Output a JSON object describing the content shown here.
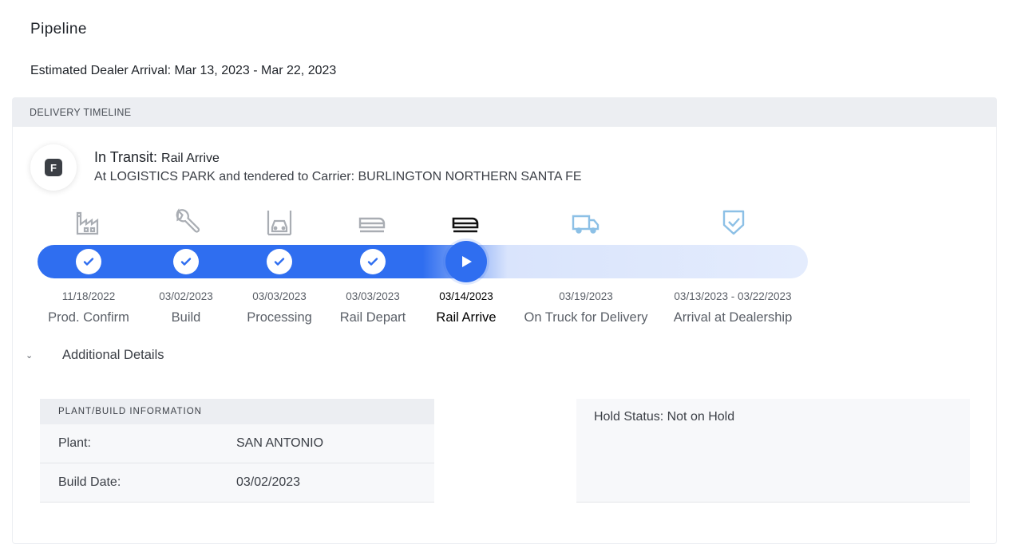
{
  "page": {
    "title": "Pipeline",
    "estimated_arrival": "Estimated Dealer Arrival: Mar 13, 2023 - Mar 22, 2023"
  },
  "timeline": {
    "header": "DELIVERY TIMELINE",
    "status_letter": "F",
    "status_label": "In Transit:",
    "status_sub": "Rail Arrive",
    "status_description": "At LOGISTICS PARK and tendered to Carrier: BURLINGTON NORTHERN SANTA FE",
    "steps": [
      {
        "date": "11/18/2022",
        "label": "Prod. Confirm",
        "icon": "factory-icon",
        "state": "complete"
      },
      {
        "date": "03/02/2023",
        "label": "Build",
        "icon": "wrench-icon",
        "state": "complete"
      },
      {
        "date": "03/03/2023",
        "label": "Processing",
        "icon": "car-service-icon",
        "state": "complete"
      },
      {
        "date": "03/03/2023",
        "label": "Rail Depart",
        "icon": "train-icon",
        "state": "complete"
      },
      {
        "date": "03/14/2023",
        "label": "Rail Arrive",
        "icon": "train-icon",
        "state": "current"
      },
      {
        "date": "03/19/2023",
        "label": "On Truck for Delivery",
        "icon": "truck-icon",
        "state": "upcoming"
      },
      {
        "date": "03/13/2023 - 03/22/2023",
        "label": "Arrival at Dealership",
        "icon": "shield-check-icon",
        "state": "upcoming"
      }
    ]
  },
  "details": {
    "toggle_label": "Additional Details",
    "plant_header": "PLANT/BUILD INFORMATION",
    "plant_rows": [
      {
        "key": "Plant:",
        "value": "SAN ANTONIO"
      },
      {
        "key": "Build Date:",
        "value": "03/02/2023"
      }
    ],
    "hold_status": "Hold Status: Not on Hold"
  },
  "colors": {
    "accent": "#2f6ef0",
    "track_light": "#e4ecfd",
    "upcoming_icon": "#8cc0e6",
    "done_icon": "#a9adb3"
  }
}
